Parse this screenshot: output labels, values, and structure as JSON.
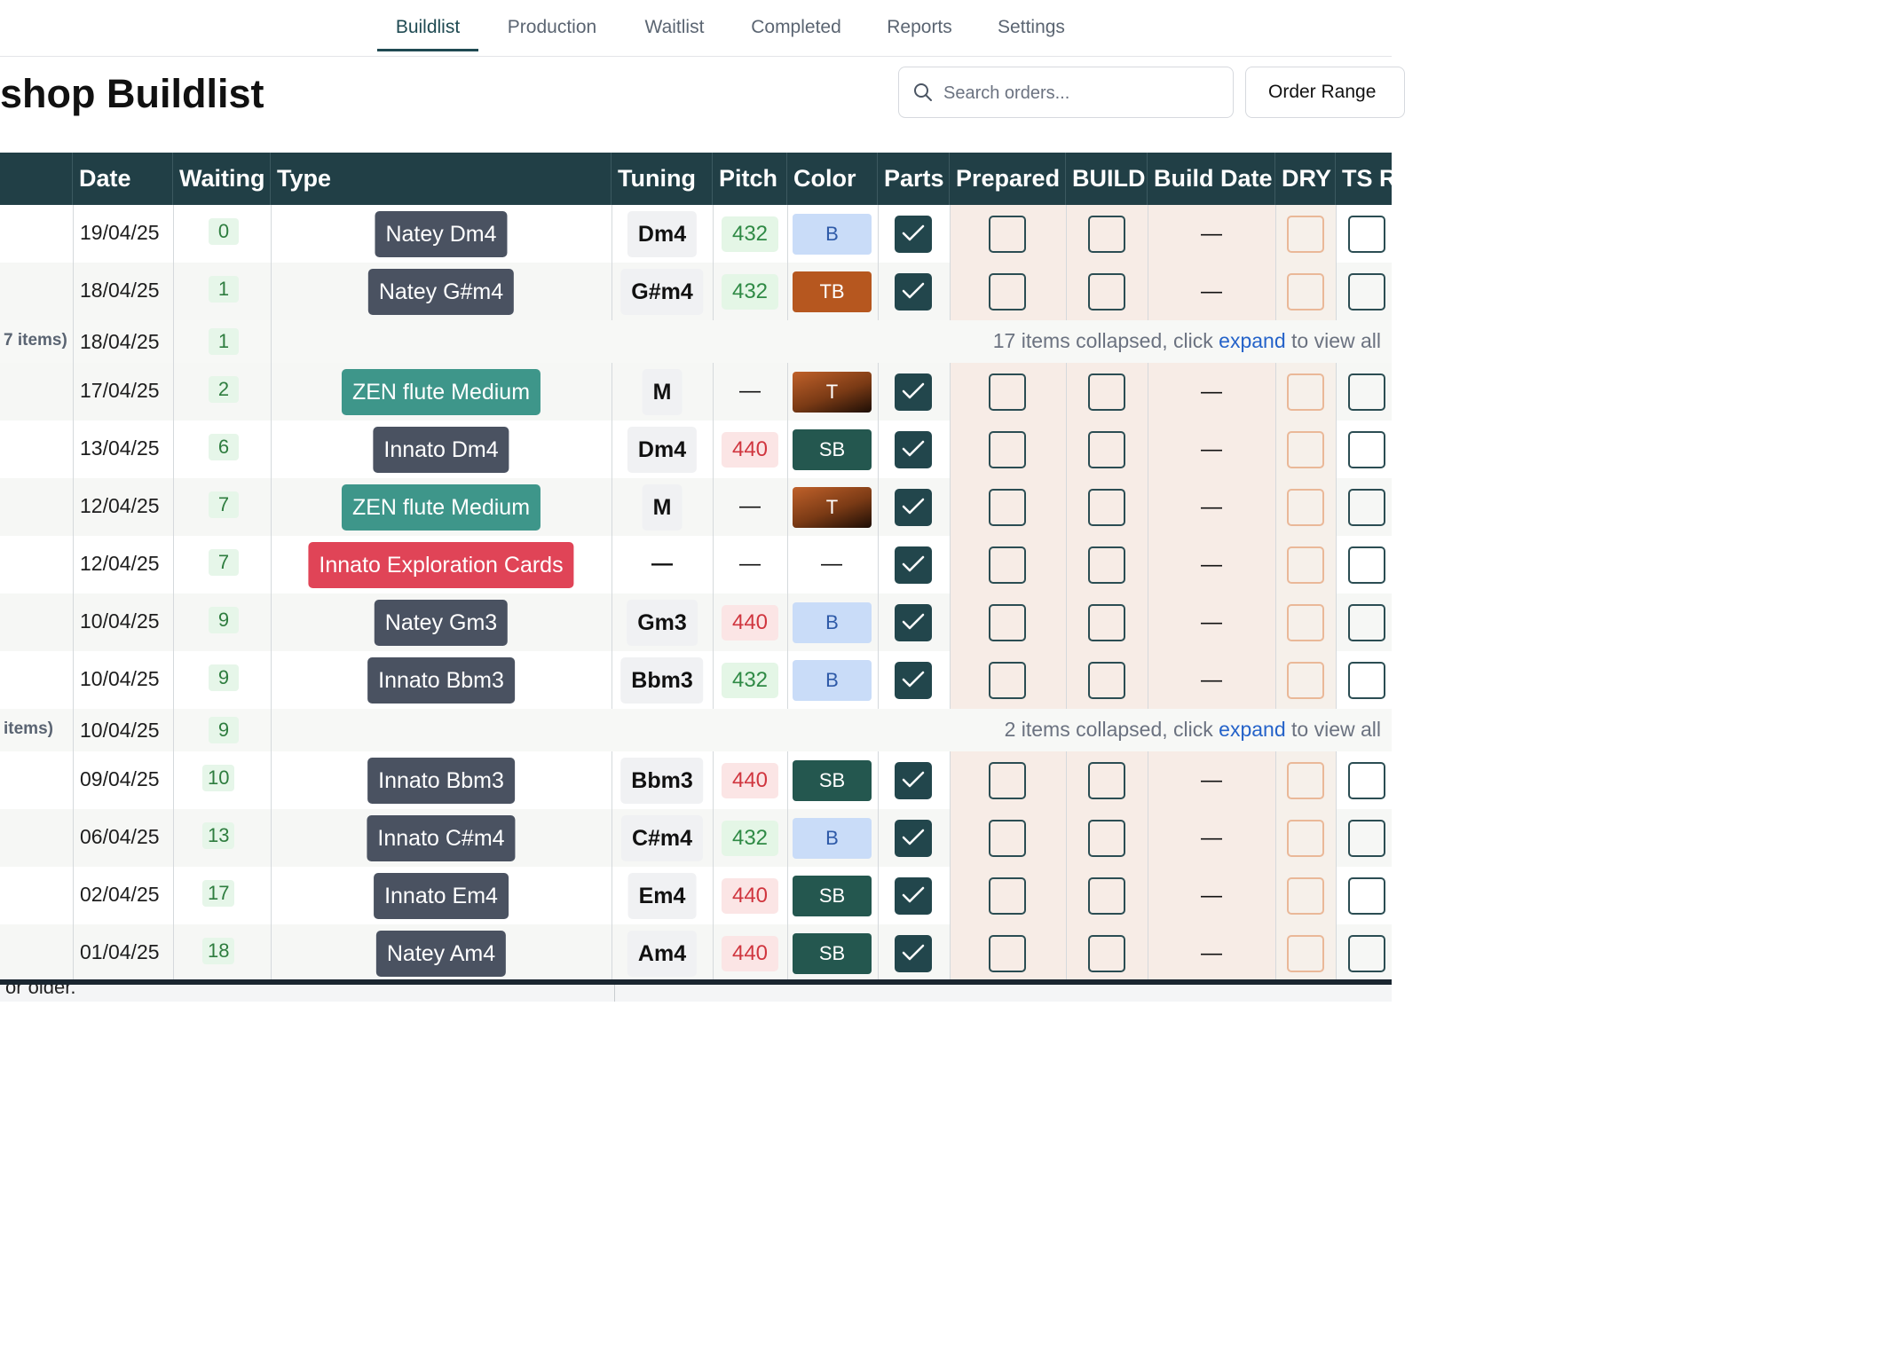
{
  "nav": {
    "tabs": [
      {
        "label": "Buildlist",
        "active": true
      },
      {
        "label": "Production"
      },
      {
        "label": "Waitlist"
      },
      {
        "label": "Completed"
      },
      {
        "label": "Reports"
      },
      {
        "label": "Settings"
      }
    ]
  },
  "header": {
    "title": "shop Buildlist",
    "search_placeholder": "Search orders...",
    "order_range_label": "Order Range"
  },
  "table": {
    "columns": [
      "Date",
      "Waiting",
      "Type",
      "Tuning",
      "Pitch",
      "Color",
      "Parts",
      "Prepared",
      "BUILD",
      "Build Date",
      "DRY",
      "TS R"
    ],
    "empty": "—",
    "rows": [
      {
        "date": "19/04/25",
        "waiting": "0",
        "type": "Natey Dm4",
        "type_color": "#4a5261",
        "tuning": "Dm4",
        "pitch": "432",
        "color_code": "B",
        "color_style": "blue",
        "parts": true
      },
      {
        "date": "18/04/25",
        "waiting": "1",
        "type": "Natey G#m4",
        "type_color": "#4a5261",
        "tuning": "G#m4",
        "pitch": "432",
        "color_code": "TB",
        "color_style": "tb",
        "parts": true
      },
      {
        "collapsed": true,
        "label": "7 items)",
        "date": "18/04/25",
        "waiting": "1",
        "message_before": "17 items collapsed, click ",
        "link": "expand",
        "message_after": " to view all"
      },
      {
        "date": "17/04/25",
        "waiting": "2",
        "type": "ZEN flute Medium",
        "type_color": "#3e968a",
        "tuning": "M",
        "pitch": "—",
        "color_code": "T",
        "color_style": "t",
        "parts": true
      },
      {
        "date": "13/04/25",
        "waiting": "6",
        "type": "Innato Dm4",
        "type_color": "#4a5261",
        "tuning": "Dm4",
        "pitch": "440",
        "color_code": "SB",
        "color_style": "sb",
        "parts": true
      },
      {
        "date": "12/04/25",
        "waiting": "7",
        "type": "ZEN flute Medium",
        "type_color": "#3e968a",
        "tuning": "M",
        "pitch": "—",
        "color_code": "T",
        "color_style": "t",
        "parts": true
      },
      {
        "date": "12/04/25",
        "waiting": "7",
        "type": "Innato Exploration Cards",
        "type_color": "#e04457",
        "tuning": "—",
        "pitch": "—",
        "color_code": "—",
        "color_style": "none",
        "parts": true
      },
      {
        "date": "10/04/25",
        "waiting": "9",
        "type": "Natey Gm3",
        "type_color": "#4a5261",
        "tuning": "Gm3",
        "pitch": "440",
        "color_code": "B",
        "color_style": "blue",
        "parts": true
      },
      {
        "date": "10/04/25",
        "waiting": "9",
        "type": "Innato Bbm3",
        "type_color": "#4a5261",
        "tuning": "Bbm3",
        "pitch": "432",
        "color_code": "B",
        "color_style": "blue",
        "parts": true
      },
      {
        "collapsed": true,
        "label": "items)",
        "date": "10/04/25",
        "waiting": "9",
        "message_before": "2 items collapsed, click ",
        "link": "expand",
        "message_after": " to view all"
      },
      {
        "date": "09/04/25",
        "waiting": "10",
        "type": "Innato Bbm3",
        "type_color": "#4a5261",
        "tuning": "Bbm3",
        "pitch": "440",
        "color_code": "SB",
        "color_style": "sb",
        "parts": true
      },
      {
        "date": "06/04/25",
        "waiting": "13",
        "type": "Innato C#m4",
        "type_color": "#4a5261",
        "tuning": "C#m4",
        "pitch": "432",
        "color_code": "B",
        "color_style": "blue",
        "parts": true
      },
      {
        "date": "02/04/25",
        "waiting": "17",
        "type": "Innato Em4",
        "type_color": "#4a5261",
        "tuning": "Em4",
        "pitch": "440",
        "color_code": "SB",
        "color_style": "sb",
        "parts": true
      },
      {
        "date": "01/04/25",
        "waiting": "18",
        "type": "Natey Am4",
        "type_color": "#4a5261",
        "tuning": "Am4",
        "pitch": "440",
        "color_code": "SB",
        "color_style": "sb",
        "parts": true
      }
    ]
  },
  "footer": {
    "text": "or older."
  }
}
